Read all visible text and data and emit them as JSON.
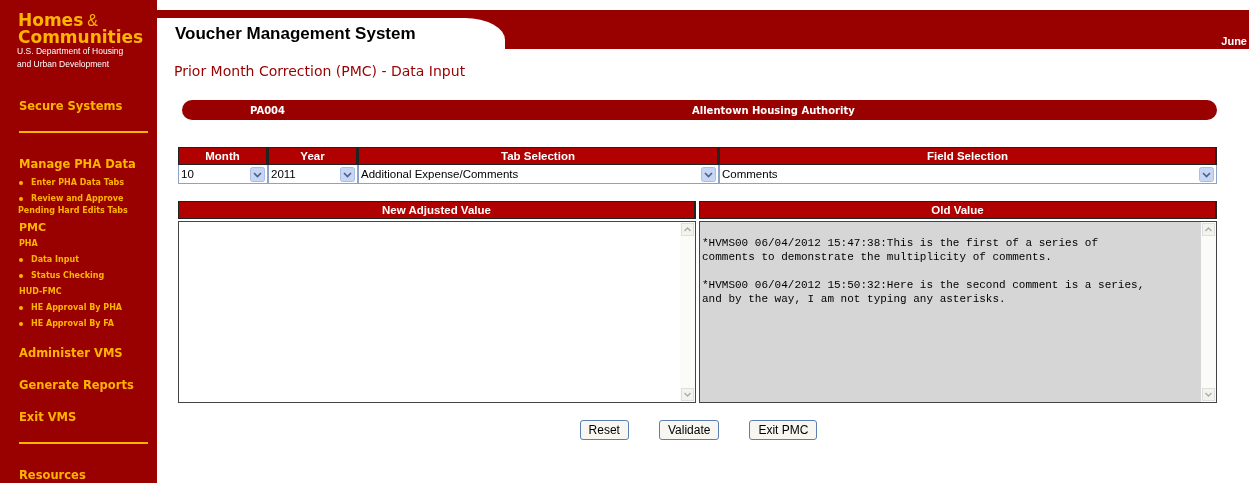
{
  "logo": {
    "title": "Homes",
    "ampersand": "&",
    "title_2": "Communities",
    "subtitle": "U.S. Department of Housing",
    "subtitle_2": "and Urban Development"
  },
  "sidebar": {
    "items": [
      {
        "kind": "section",
        "label": "Secure Systems"
      },
      {
        "kind": "divider"
      },
      {
        "kind": "section",
        "label": "Manage PHA Data"
      },
      {
        "kind": "bullet",
        "label": "Enter PHA Data Tabs"
      },
      {
        "kind": "bullet",
        "label": "Review and Approve",
        "continuation": "Pending Hard Edits Tabs"
      },
      {
        "kind": "group",
        "label": "PMC"
      },
      {
        "kind": "small",
        "label": "PHA"
      },
      {
        "kind": "bullet",
        "label": "Data Input"
      },
      {
        "kind": "bullet",
        "label": "Status Checking"
      },
      {
        "kind": "small",
        "label": "HUD-FMC"
      },
      {
        "kind": "bullet",
        "label": "HE Approval By PHA"
      },
      {
        "kind": "bullet",
        "label": "HE Approval By FA"
      },
      {
        "kind": "section",
        "label": "Administer VMS"
      },
      {
        "kind": "section",
        "label": "Generate Reports"
      },
      {
        "kind": "section",
        "label": "Exit VMS"
      },
      {
        "kind": "divider"
      },
      {
        "kind": "section",
        "label": "Resources"
      }
    ]
  },
  "header": {
    "title": "Voucher Management System",
    "date": "June"
  },
  "page_title": "Prior Month Correction (PMC) - Data Input",
  "pha_bar": {
    "code": "PA004",
    "name": "Allentown Housing Authority"
  },
  "selections": [
    {
      "heading": "Month",
      "value": "10"
    },
    {
      "heading": "Year",
      "value": "2011"
    },
    {
      "heading": "Tab Selection",
      "value": "Additional Expense/Comments"
    },
    {
      "heading": "Field Selection",
      "value": "Comments"
    }
  ],
  "new_value": {
    "heading": "New Adjusted Value"
  },
  "old_value": {
    "heading": "Old Value",
    "comments": [
      {
        "lines": [
          "*HVMS00 06/04/2012 15:47:38:This is the first of a series of",
          "comments to demonstrate the multiplicity of comments."
        ]
      },
      {
        "lines": [
          "*HVMS00 06/04/2012 15:50:32:Here is the second comment is a series,",
          "and by the way, I am not typing any asterisks."
        ]
      }
    ]
  },
  "buttons": [
    "Reset",
    "Validate",
    "Exit PMC"
  ]
}
